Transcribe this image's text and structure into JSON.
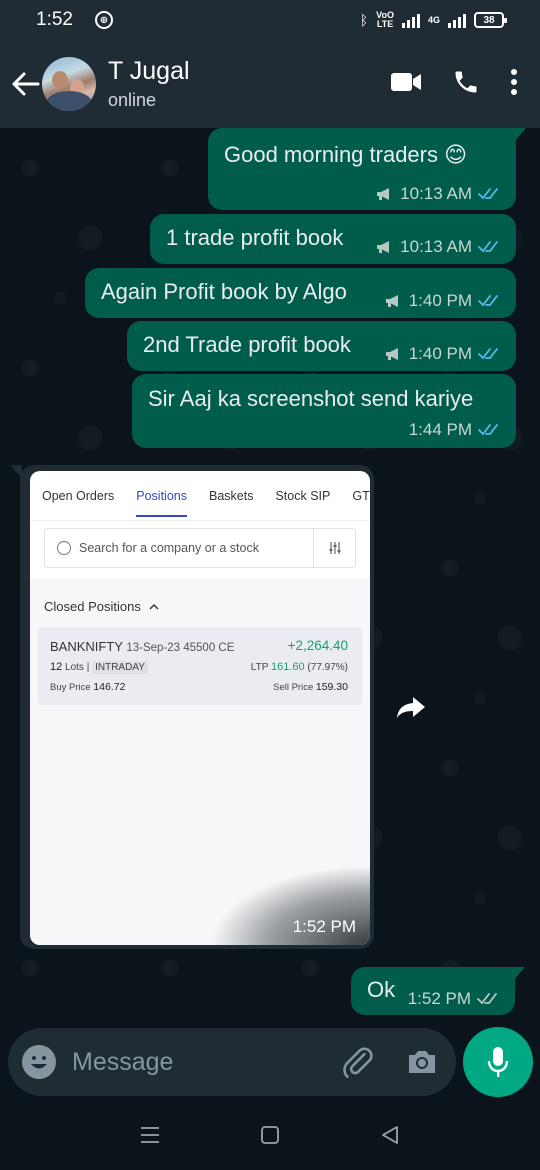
{
  "status_bar": {
    "time": "1:52",
    "network_label": "4G",
    "volte_line1": "VoO",
    "volte_line2": "LTE",
    "battery": "38"
  },
  "header": {
    "contact_name": "T Jugal",
    "contact_status": "online"
  },
  "messages": [
    {
      "text": "Good morning traders 😊",
      "time": "10:13 AM"
    },
    {
      "text": "1 trade profit book",
      "time": "10:13 AM"
    },
    {
      "text": "Again Profit book by Algo",
      "time": "1:40 PM"
    },
    {
      "text": "2nd Trade profit book",
      "time": "1:40 PM"
    },
    {
      "text": "Sir Aaj ka screenshot send kariye",
      "time": "1:44 PM"
    }
  ],
  "image_message": {
    "time": "1:52 PM",
    "screenshot": {
      "tabs": [
        "Open Orders",
        "Positions",
        "Baskets",
        "Stock SIP",
        "GT"
      ],
      "active_tab": "Positions",
      "search_placeholder": "Search for a company or a stock",
      "section_label": "Closed Positions",
      "position": {
        "symbol": "BANKNIFTY",
        "contract": "13-Sep-23 45500 CE",
        "pnl": "+2,264.40",
        "lots_value": "12",
        "lots_label": "Lots",
        "product": "INTRADAY",
        "ltp_label": "LTP",
        "ltp_value": "161.60",
        "ltp_change": "(77.97%)",
        "buy_label": "Buy Price",
        "buy_value": "146.72",
        "sell_label": "Sell Price",
        "sell_value": "159.30"
      }
    }
  },
  "last_message": {
    "text": "Ok",
    "time": "1:52 PM"
  },
  "composer": {
    "placeholder": "Message"
  },
  "colors": {
    "outgoing_bubble": "#005c4b",
    "header_bg": "#1f2c34",
    "chat_bg": "#0b141a",
    "mic_button": "#00a884",
    "read_ticks": "#53bdeb",
    "profit_green": "#1a9e72"
  }
}
